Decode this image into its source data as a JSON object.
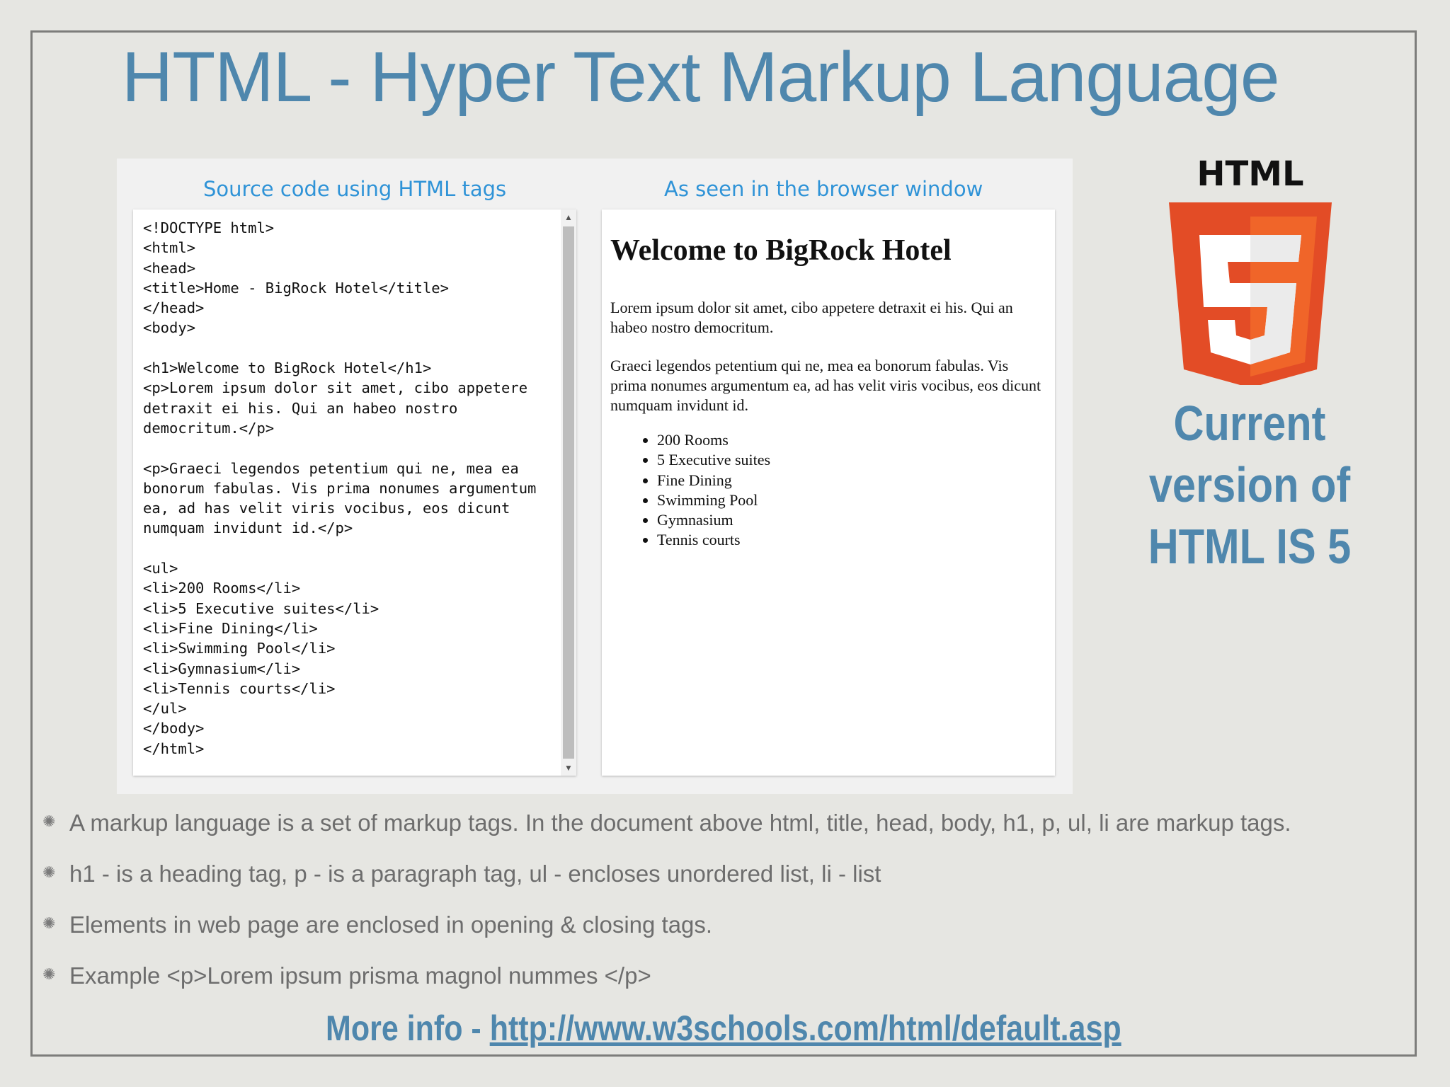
{
  "slide": {
    "title": "HTML - Hyper Text Markup Language",
    "source_caption": "Source code using HTML tags",
    "browser_caption": "As seen in the browser window",
    "source_code": "<!DOCTYPE html>\n<html>\n<head>\n<title>Home - BigRock Hotel</title>\n</head>\n<body>\n\n<h1>Welcome to BigRock Hotel</h1>\n<p>Lorem ipsum dolor sit amet, cibo appetere\ndetraxit ei his. Qui an habeo nostro\ndemocritum.</p>\n\n<p>Graeci legendos petentium qui ne, mea ea\nbonorum fabulas. Vis prima nonumes argumentum\nea, ad has velit viris vocibus, eos dicunt\nnumquam invidunt id.</p>\n\n<ul>\n<li>200 Rooms</li>\n<li>5 Executive suites</li>\n<li>Fine Dining</li>\n<li>Swimming Pool</li>\n<li>Gymnasium</li>\n<li>Tennis courts</li>\n</ul>\n</body>\n</html>",
    "rendered": {
      "heading": "Welcome to BigRock Hotel",
      "paragraph1": "Lorem ipsum dolor sit amet, cibo appetere detraxit ei his. Qui an habeo nostro democritum.",
      "paragraph2": "Graeci legendos petentium qui ne, mea ea bonorum fabulas. Vis prima nonumes argumentum ea, ad has velit viris vocibus, eos dicunt numquam invidunt id.",
      "list": [
        "200 Rooms",
        "5 Executive suites",
        "Fine Dining",
        "Swimming Pool",
        "Gymnasium",
        "Tennis courts"
      ]
    },
    "logo": {
      "label": "HTML",
      "digit": "5",
      "colors": {
        "shield_dark": "#e34c26",
        "shield_light": "#f06529",
        "digit_light": "#ffffff",
        "digit_shade": "#ebebeb"
      }
    },
    "side_note": [
      "Current",
      "version of",
      "HTML IS 5"
    ],
    "bullets": [
      "A markup language is a set of markup tags. In the document above html, title, head, body, h1, p, ul, li are markup tags.",
      "h1 - is a heading tag, p - is a paragraph tag, ul - encloses unordered list, li - list",
      "Elements in web page are enclosed in opening & closing tags.",
      "Example <p>Lorem ipsum prisma magnol nummes </p>"
    ],
    "more_info": {
      "prefix": "More info - ",
      "link_text": "http://www.w3schools.com/html/default.asp"
    },
    "colors": {
      "title": "#4f87ad",
      "caption": "#2f93d7",
      "bullet_text": "#6d6d6d"
    },
    "icons": {
      "bullet": "asterisk-bullet-icon",
      "scroll_up": "triangle-up-icon",
      "scroll_down": "triangle-down-icon"
    }
  }
}
